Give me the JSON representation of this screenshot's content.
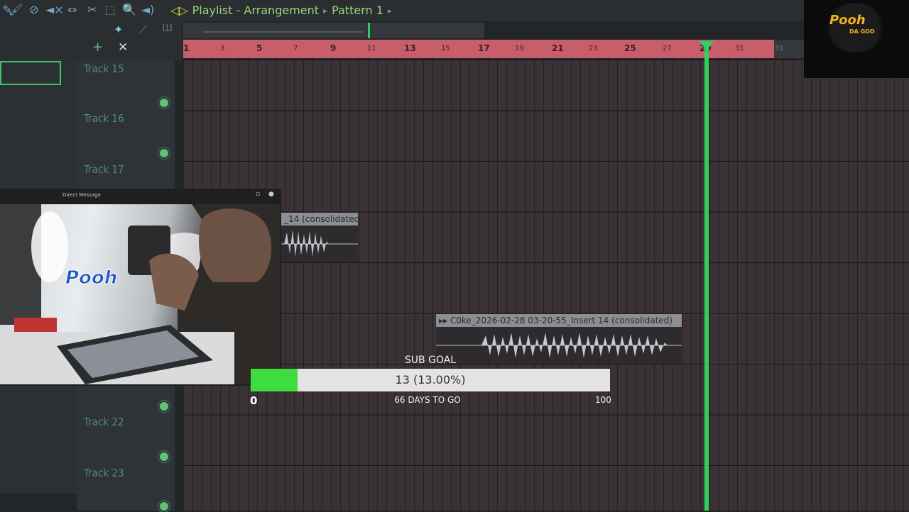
{
  "window": {
    "title": "Playlist - Arrangement",
    "pattern": "Pattern 1"
  },
  "toolbar": {
    "icons": [
      "draw-icon",
      "paint-icon",
      "delete-icon",
      "mute-icon",
      "slip-icon",
      "slice-icon",
      "select-icon",
      "zoom-icon",
      "playback-icon"
    ]
  },
  "ruler": {
    "labels": [
      "1",
      "3",
      "5",
      "7",
      "9",
      "11",
      "13",
      "15",
      "17",
      "19",
      "21",
      "23",
      "25",
      "27",
      "29",
      "31",
      "33"
    ]
  },
  "tracks": [
    {
      "label": "Track 15"
    },
    {
      "label": "Track 16"
    },
    {
      "label": "Track 17"
    },
    {
      "label": "Track 22"
    },
    {
      "label": "Track 23"
    }
  ],
  "clips": [
    {
      "label": "_14 (consolidated)"
    },
    {
      "label": "C0ke_2026-02-28 03-20-55_Insert 14 (consolidated)"
    }
  ],
  "webcam": {
    "window_title": "Direct Message",
    "overlay_logo": "Pooh"
  },
  "logo": {
    "text": "Pooh",
    "sub": "DA GOD"
  },
  "sub_goal": {
    "title": "SUB GOAL",
    "progress_text": "13 (13.00%)",
    "progress_percent": 13,
    "min": "0",
    "max": "100",
    "days_left": "66 DAYS TO GO"
  },
  "colors": {
    "accent": "#2ed15a",
    "ruler": "#c85e6c",
    "title": "#9ad57a",
    "goal_fill": "#3fdc3f"
  }
}
